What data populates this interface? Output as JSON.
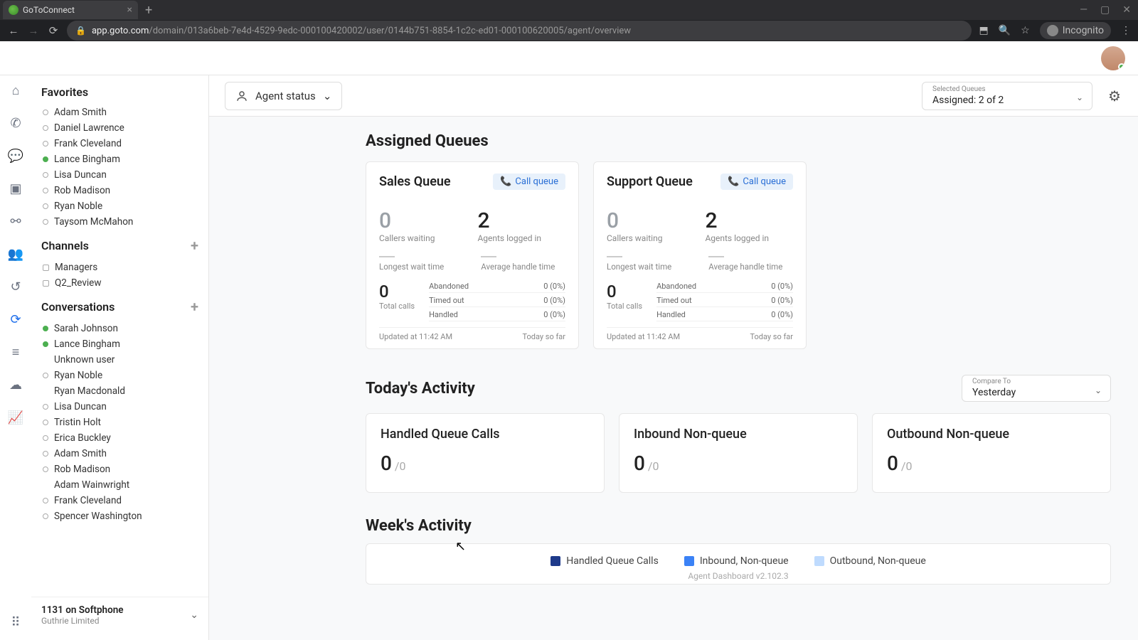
{
  "browser": {
    "tab_title": "GoToConnect",
    "url_host": "app.goto.com",
    "url_path": "/domain/013a6beb-7e4d-4529-9edc-000100420002/user/0144b751-8854-1c2c-ed01-000100620005/agent/overview",
    "incognito": "Incognito"
  },
  "toolbar": {
    "agent_status": "Agent status",
    "selected_queues_label": "Selected Queues",
    "selected_queues_value": "Assigned: 2 of 2"
  },
  "sidebar": {
    "favorites_title": "Favorites",
    "favorites": [
      {
        "name": "Adam Smith",
        "online": false
      },
      {
        "name": "Daniel Lawrence",
        "online": false
      },
      {
        "name": "Frank Cleveland",
        "online": false
      },
      {
        "name": "Lance Bingham",
        "online": true
      },
      {
        "name": "Lisa Duncan",
        "online": false
      },
      {
        "name": "Rob Madison",
        "online": false
      },
      {
        "name": "Ryan Noble",
        "online": false
      },
      {
        "name": "Taysom McMahon",
        "online": false
      }
    ],
    "channels_title": "Channels",
    "channels": [
      {
        "name": "Managers"
      },
      {
        "name": "Q2_Review"
      }
    ],
    "conversations_title": "Conversations",
    "conversations": [
      {
        "name": "Sarah Johnson",
        "online": true
      },
      {
        "name": "Lance Bingham",
        "online": true
      },
      {
        "name": "Unknown user",
        "online": null
      },
      {
        "name": "Ryan Noble",
        "online": false
      },
      {
        "name": "Ryan Macdonald",
        "online": null
      },
      {
        "name": "Lisa Duncan",
        "online": false
      },
      {
        "name": "Tristin Holt",
        "online": false
      },
      {
        "name": "Erica Buckley",
        "online": false
      },
      {
        "name": "Adam Smith",
        "online": false
      },
      {
        "name": "Rob Madison",
        "online": false
      },
      {
        "name": "Adam Wainwright",
        "online": null
      },
      {
        "name": "Frank Cleveland",
        "online": false
      },
      {
        "name": "Spencer Washington",
        "online": false
      }
    ],
    "footer_main": "1131 on Softphone",
    "footer_sub": "Guthrie Limited"
  },
  "assigned_queues": {
    "title": "Assigned Queues",
    "call_queue_label": "Call queue",
    "labels": {
      "callers_waiting": "Callers waiting",
      "agents_logged": "Agents logged in",
      "longest_wait": "Longest wait time",
      "avg_handle": "Average handle time",
      "total_calls": "Total calls",
      "abandoned": "Abandoned",
      "timed_out": "Timed out",
      "handled": "Handled",
      "today_so_far": "Today so far"
    },
    "queues": [
      {
        "name": "Sales Queue",
        "callers_waiting": "0",
        "agents_logged": "2",
        "total_calls": "0",
        "abandoned": "0 (0%)",
        "timed_out": "0 (0%)",
        "handled": "0 (0%)",
        "updated": "Updated at 11:42 AM"
      },
      {
        "name": "Support Queue",
        "callers_waiting": "0",
        "agents_logged": "2",
        "total_calls": "0",
        "abandoned": "0 (0%)",
        "timed_out": "0 (0%)",
        "handled": "0 (0%)",
        "updated": "Updated at 11:42 AM"
      }
    ]
  },
  "today_activity": {
    "title": "Today's Activity",
    "compare_label": "Compare To",
    "compare_value": "Yesterday",
    "cards": [
      {
        "title": "Handled Queue Calls",
        "value": "0",
        "compare": "/0"
      },
      {
        "title": "Inbound Non-queue",
        "value": "0",
        "compare": "/0"
      },
      {
        "title": "Outbound Non-queue",
        "value": "0",
        "compare": "/0"
      }
    ]
  },
  "week_activity": {
    "title": "Week's Activity",
    "legend": [
      {
        "label": "Handled Queue Calls",
        "color": "#1e3a8a"
      },
      {
        "label": "Inbound, Non-queue",
        "color": "#3b82f6"
      },
      {
        "label": "Outbound, Non-queue",
        "color": "#bfdbfe"
      }
    ],
    "version": "Agent Dashboard v2.102.3"
  },
  "chart_data": {
    "type": "bar",
    "title": "Week's Activity",
    "series": [
      {
        "name": "Handled Queue Calls",
        "color": "#1e3a8a"
      },
      {
        "name": "Inbound, Non-queue",
        "color": "#3b82f6"
      },
      {
        "name": "Outbound, Non-queue",
        "color": "#bfdbfe"
      }
    ],
    "note": "chart body not visible in viewport; legend only"
  }
}
